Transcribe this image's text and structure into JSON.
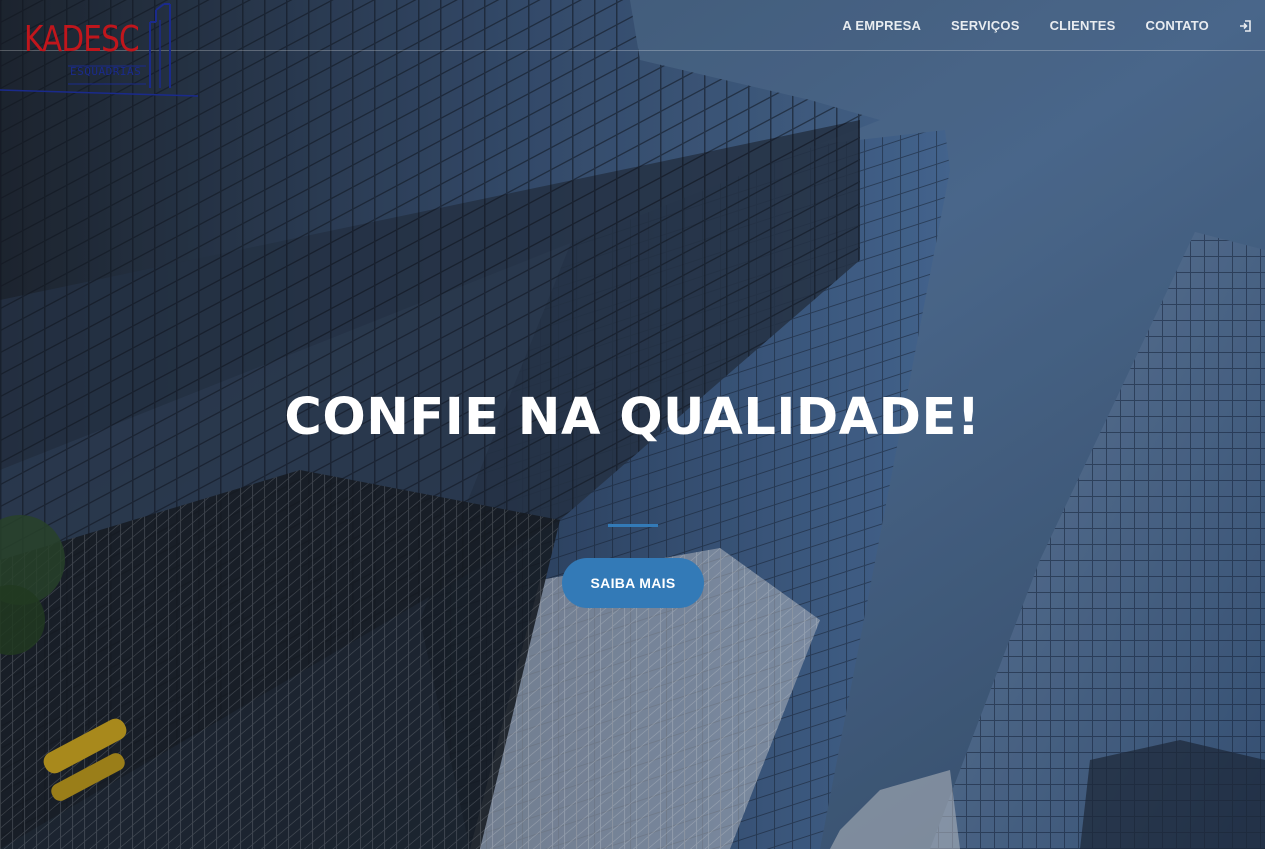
{
  "brand": {
    "name": "KADESC",
    "tagline": "ESQUADRIAS",
    "primary_color": "#c0161c",
    "secondary_color": "#1a2a8c"
  },
  "nav": {
    "items": [
      {
        "label": "A EMPRESA"
      },
      {
        "label": "SERVIÇOS"
      },
      {
        "label": "CLIENTES"
      },
      {
        "label": "CONTATO"
      }
    ],
    "login_icon": "sign-in-icon"
  },
  "hero": {
    "headline": "CONFIE NA QUALIDADE!",
    "cta_label": "SAIBA MAIS",
    "accent_color": "#337ab7"
  }
}
